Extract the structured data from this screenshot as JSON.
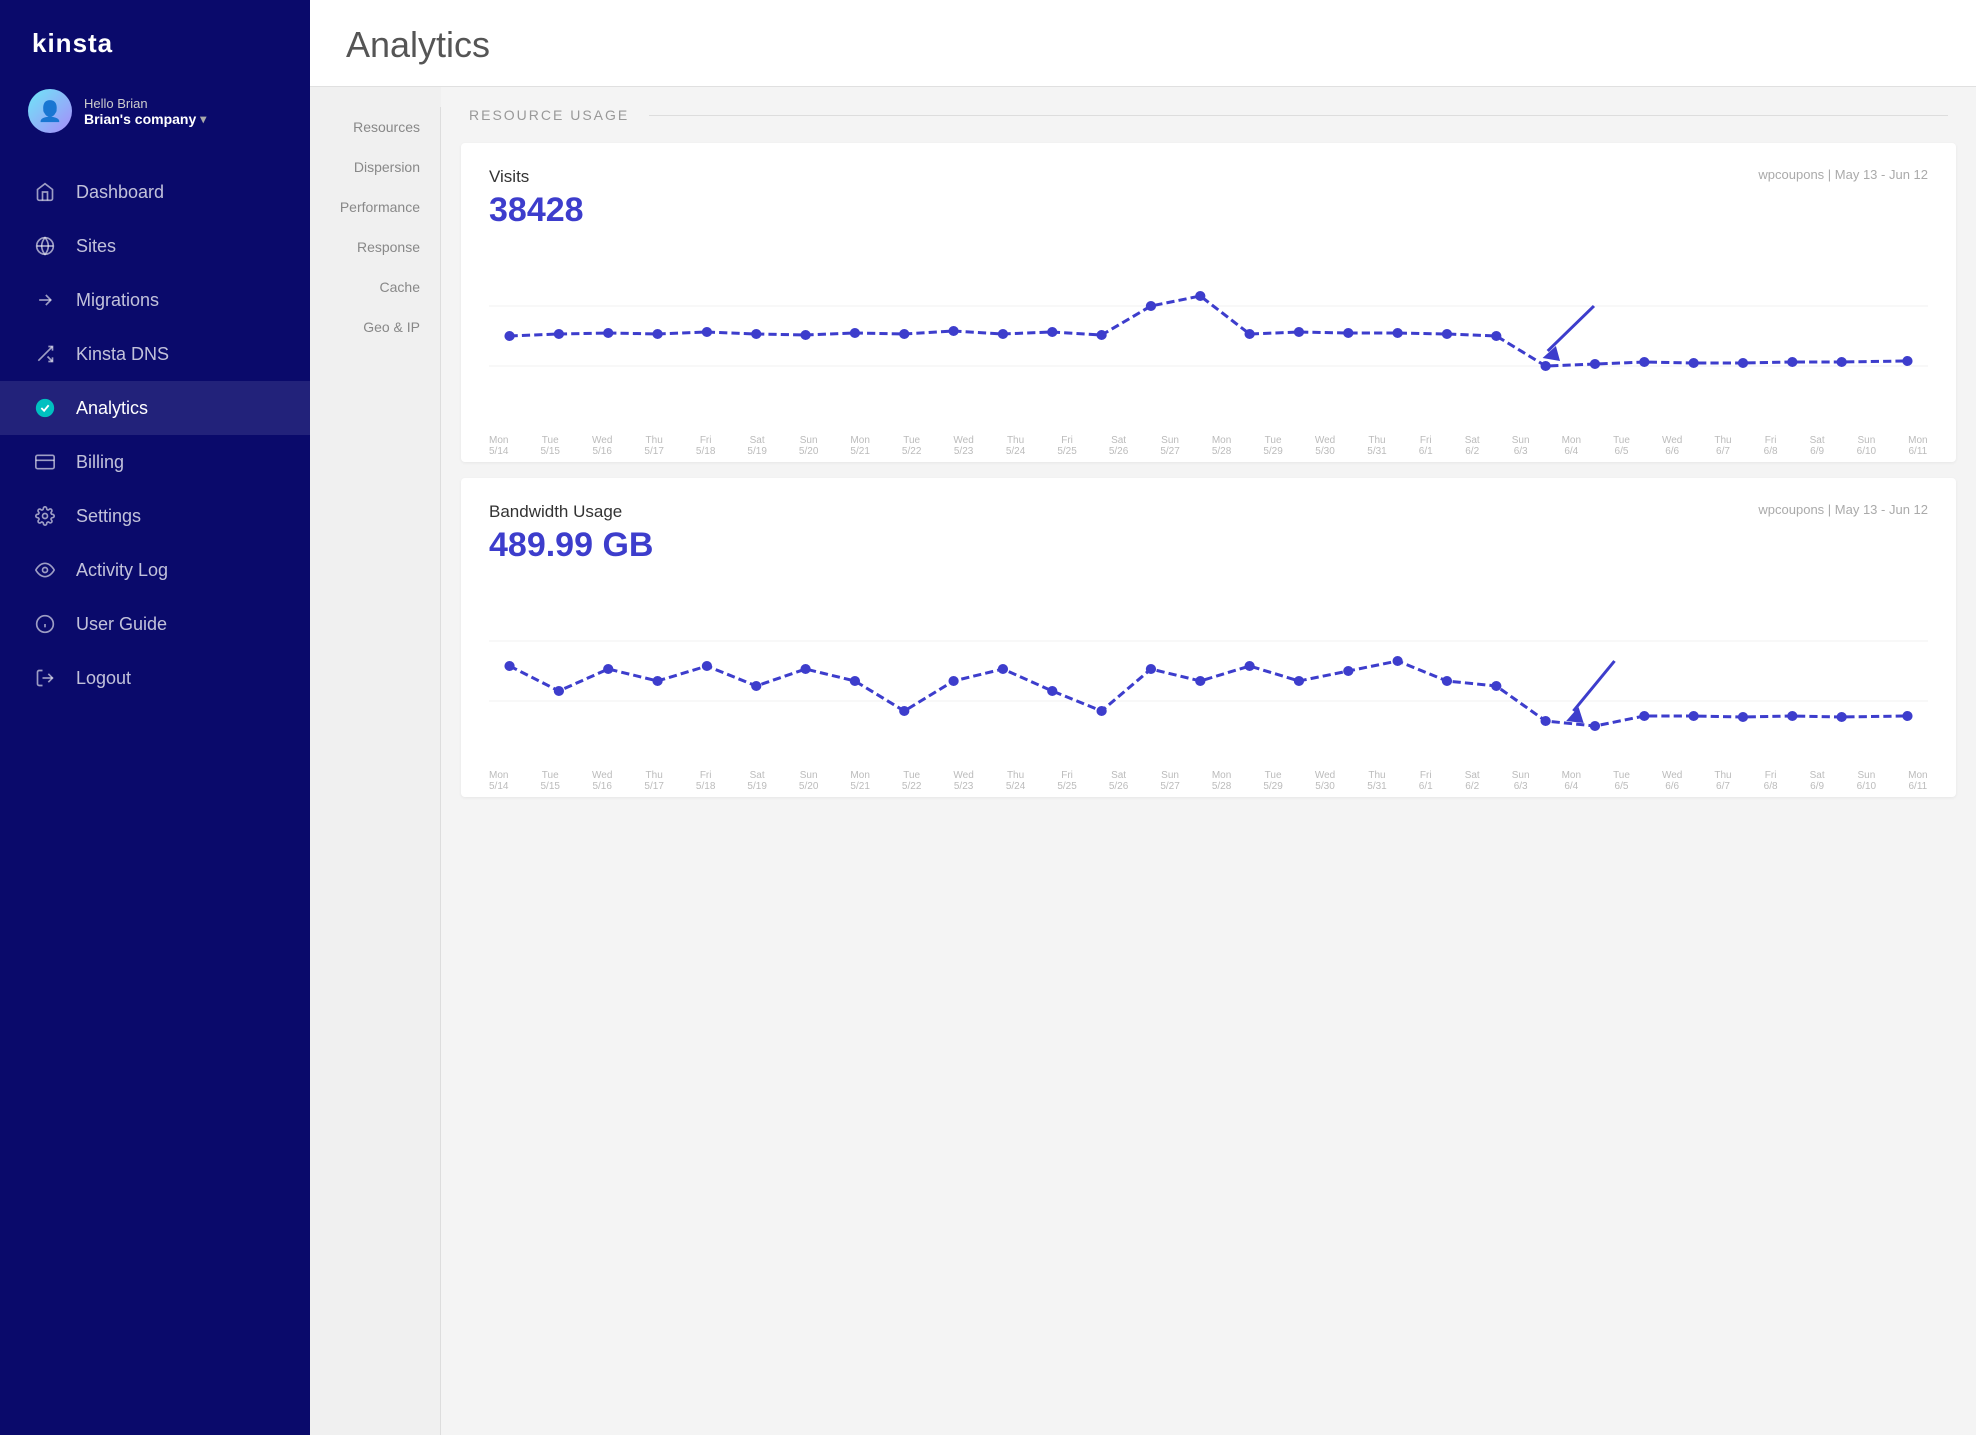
{
  "sidebar": {
    "logo": "kinsta",
    "user": {
      "greeting": "Hello Brian",
      "company": "Brian's company"
    },
    "items": [
      {
        "id": "dashboard",
        "label": "Dashboard",
        "icon": "house"
      },
      {
        "id": "sites",
        "label": "Sites",
        "icon": "globe"
      },
      {
        "id": "migrations",
        "label": "Migrations",
        "icon": "arrow-right"
      },
      {
        "id": "kinsta-dns",
        "label": "Kinsta DNS",
        "icon": "dns"
      },
      {
        "id": "analytics",
        "label": "Analytics",
        "icon": "chart",
        "active": true
      },
      {
        "id": "billing",
        "label": "Billing",
        "icon": "credit-card"
      },
      {
        "id": "settings",
        "label": "Settings",
        "icon": "gear"
      },
      {
        "id": "activity-log",
        "label": "Activity Log",
        "icon": "eye"
      },
      {
        "id": "user-guide",
        "label": "User Guide",
        "icon": "info"
      },
      {
        "id": "logout",
        "label": "Logout",
        "icon": "logout"
      }
    ]
  },
  "page": {
    "title": "Analytics"
  },
  "subnav": {
    "items": [
      {
        "id": "resources",
        "label": "Resources"
      },
      {
        "id": "dispersion",
        "label": "Dispersion"
      },
      {
        "id": "performance",
        "label": "Performance"
      },
      {
        "id": "response",
        "label": "Response"
      },
      {
        "id": "cache",
        "label": "Cache"
      },
      {
        "id": "geo-ip",
        "label": "Geo & IP"
      }
    ]
  },
  "resource_section": {
    "title": "RESOURCE USAGE"
  },
  "charts": [
    {
      "id": "visits",
      "label": "Visits",
      "value": "38428",
      "site_info": "wpcoupons | May 13 - Jun 12",
      "x_labels": [
        {
          "day": "Mon",
          "date": "5/14"
        },
        {
          "day": "Tue",
          "date": "5/15"
        },
        {
          "day": "Wed",
          "date": "5/16"
        },
        {
          "day": "Thu",
          "date": "5/17"
        },
        {
          "day": "Fri",
          "date": "5/18"
        },
        {
          "day": "Sat",
          "date": "5/19"
        },
        {
          "day": "Sun",
          "date": "5/20"
        },
        {
          "day": "Mon",
          "date": "5/21"
        },
        {
          "day": "Tue",
          "date": "5/22"
        },
        {
          "day": "Wed",
          "date": "5/23"
        },
        {
          "day": "Thu",
          "date": "5/24"
        },
        {
          "day": "Fri",
          "date": "5/25"
        },
        {
          "day": "Sat",
          "date": "5/26"
        },
        {
          "day": "Sun",
          "date": "5/27"
        },
        {
          "day": "Mon",
          "date": "5/28"
        },
        {
          "day": "Tue",
          "date": "5/29"
        },
        {
          "day": "Wed",
          "date": "5/30"
        },
        {
          "day": "Thu",
          "date": "5/31"
        },
        {
          "day": "Fri",
          "date": "6/1"
        },
        {
          "day": "Sat",
          "date": "6/2"
        },
        {
          "day": "Sun",
          "date": "6/3"
        },
        {
          "day": "Mon",
          "date": "6/4"
        },
        {
          "day": "Tue",
          "date": "6/5"
        },
        {
          "day": "Wed",
          "date": "6/6"
        },
        {
          "day": "Thu",
          "date": "6/7"
        },
        {
          "day": "Fri",
          "date": "6/8"
        },
        {
          "day": "Sat",
          "date": "6/9"
        },
        {
          "day": "Sun",
          "date": "6/10"
        },
        {
          "day": "Mon",
          "date": "6/11"
        }
      ]
    },
    {
      "id": "bandwidth",
      "label": "Bandwidth Usage",
      "value": "489.99 GB",
      "site_info": "wpcoupons | May 13 - Jun 12",
      "x_labels": [
        {
          "day": "Mon",
          "date": "5/14"
        },
        {
          "day": "Tue",
          "date": "5/15"
        },
        {
          "day": "Wed",
          "date": "5/16"
        },
        {
          "day": "Thu",
          "date": "5/17"
        },
        {
          "day": "Fri",
          "date": "5/18"
        },
        {
          "day": "Sat",
          "date": "5/19"
        },
        {
          "day": "Sun",
          "date": "5/20"
        },
        {
          "day": "Mon",
          "date": "5/21"
        },
        {
          "day": "Tue",
          "date": "5/22"
        },
        {
          "day": "Wed",
          "date": "5/23"
        },
        {
          "day": "Thu",
          "date": "5/24"
        },
        {
          "day": "Fri",
          "date": "5/25"
        },
        {
          "day": "Sat",
          "date": "5/26"
        },
        {
          "day": "Sun",
          "date": "5/27"
        },
        {
          "day": "Mon",
          "date": "5/28"
        },
        {
          "day": "Tue",
          "date": "5/29"
        },
        {
          "day": "Wed",
          "date": "5/30"
        },
        {
          "day": "Thu",
          "date": "5/31"
        },
        {
          "day": "Fri",
          "date": "6/1"
        },
        {
          "day": "Sat",
          "date": "6/2"
        },
        {
          "day": "Sun",
          "date": "6/3"
        },
        {
          "day": "Mon",
          "date": "6/4"
        },
        {
          "day": "Tue",
          "date": "6/5"
        },
        {
          "day": "Wed",
          "date": "6/6"
        },
        {
          "day": "Thu",
          "date": "6/7"
        },
        {
          "day": "Fri",
          "date": "6/8"
        },
        {
          "day": "Sat",
          "date": "6/9"
        },
        {
          "day": "Sun",
          "date": "6/10"
        },
        {
          "day": "Mon",
          "date": "6/11"
        }
      ]
    }
  ]
}
